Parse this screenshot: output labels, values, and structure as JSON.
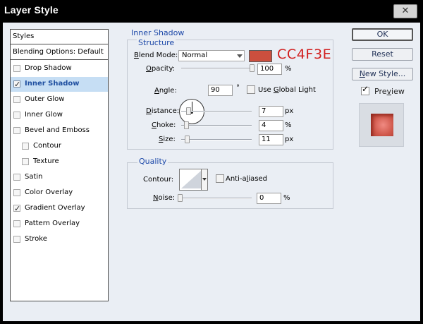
{
  "window": {
    "title": "Layer Style",
    "close_icon": "close-icon"
  },
  "styles_list": {
    "header": "Styles",
    "blending": "Blending Options: Default",
    "items": [
      {
        "label": "Drop Shadow",
        "checked": false,
        "selected": false,
        "indent": false
      },
      {
        "label": "Inner Shadow",
        "checked": true,
        "selected": true,
        "indent": false
      },
      {
        "label": "Outer Glow",
        "checked": false,
        "selected": false,
        "indent": false
      },
      {
        "label": "Inner Glow",
        "checked": false,
        "selected": false,
        "indent": false
      },
      {
        "label": "Bevel and Emboss",
        "checked": false,
        "selected": false,
        "indent": false
      },
      {
        "label": "Contour",
        "checked": false,
        "selected": false,
        "indent": true
      },
      {
        "label": "Texture",
        "checked": false,
        "selected": false,
        "indent": true
      },
      {
        "label": "Satin",
        "checked": false,
        "selected": false,
        "indent": false
      },
      {
        "label": "Color Overlay",
        "checked": false,
        "selected": false,
        "indent": false
      },
      {
        "label": "Gradient Overlay",
        "checked": true,
        "selected": false,
        "indent": false
      },
      {
        "label": "Pattern Overlay",
        "checked": false,
        "selected": false,
        "indent": false
      },
      {
        "label": "Stroke",
        "checked": false,
        "selected": false,
        "indent": false
      }
    ]
  },
  "inner_shadow": {
    "section_title": "Inner Shadow",
    "structure_title": "Structure",
    "blend_mode": {
      "label": "Blend Mode:",
      "value": "Normal"
    },
    "color": {
      "hex": "#CC4F3E",
      "annotation": "CC4F3E"
    },
    "opacity": {
      "label": "Opacity:",
      "value": "100",
      "unit": "%",
      "level": 1.0
    },
    "angle": {
      "label": "Angle:",
      "value": "90",
      "unit": "°",
      "global_light_label": "Use Global Light",
      "global_light_checked": false
    },
    "distance": {
      "label": "Distance:",
      "value": "7",
      "unit": "px",
      "level": 0.07
    },
    "choke": {
      "label": "Choke:",
      "value": "4",
      "unit": "%",
      "level": 0.04
    },
    "size": {
      "label": "Size:",
      "value": "11",
      "unit": "px",
      "level": 0.05
    }
  },
  "quality": {
    "title": "Quality",
    "contour_label": "Contour:",
    "anti_aliased_label": "Anti-aliased",
    "anti_aliased_checked": false,
    "noise": {
      "label": "Noise:",
      "value": "0",
      "unit": "%",
      "level": 0.0
    }
  },
  "buttons": {
    "ok": "OK",
    "reset": "Reset",
    "new_style": "New Style...",
    "preview_label": "Preview",
    "preview_checked": true
  },
  "colors": {
    "accent": "#1C48A8",
    "shadow_color": "#CC4F3E",
    "annotation_color": "#D11D1D"
  }
}
